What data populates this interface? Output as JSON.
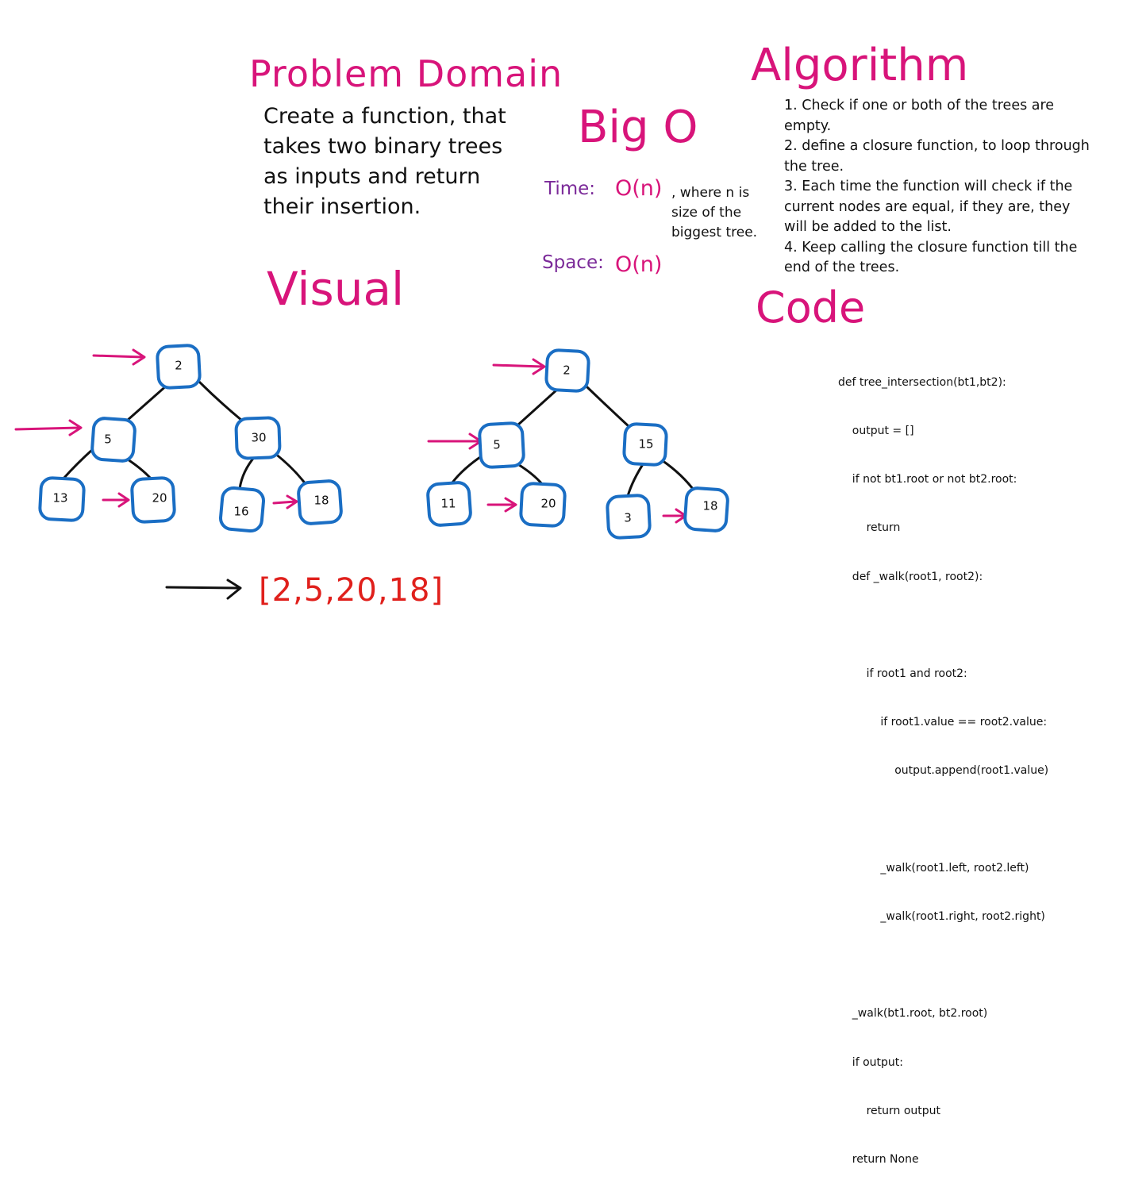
{
  "headings": {
    "problem_domain": "Problem Domain",
    "algorithm": "Algorithm",
    "big_o": "Big O",
    "visual": "Visual",
    "code": "Code"
  },
  "problem_domain": {
    "lines": [
      "Create a function, that",
      "takes two binary trees",
      "as inputs and return",
      "their insertion."
    ]
  },
  "big_o": {
    "time_label": "Time:",
    "time_value": "O(n)",
    "time_note": [
      ", where n is",
      "size of the",
      "biggest tree."
    ],
    "space_label": "Space:",
    "space_value": "O(n)"
  },
  "algorithm": {
    "lines": [
      "1. Check if one or both of the trees are",
      "empty.",
      "2. define a closure function, to loop through",
      "the tree.",
      "3. Each time the function will check if the",
      "current nodes are equal, if they are, they",
      "will be added to the list.",
      "4. Keep calling the closure function till the",
      "end of the trees."
    ]
  },
  "code": {
    "lines": [
      "def tree_intersection(bt1,bt2):",
      "    output = []",
      "    if not bt1.root or not bt2.root:",
      "        return",
      "    def _walk(root1, root2):",
      "",
      "        if root1 and root2:",
      "            if root1.value == root2.value:",
      "                output.append(root1.value)",
      "",
      "            _walk(root1.left, root2.left)",
      "            _walk(root1.right, root2.right)",
      "",
      "    _walk(bt1.root, bt2.root)",
      "    if output:",
      "        return output",
      "    return None"
    ]
  },
  "trees": {
    "tree1": {
      "nodes": [
        {
          "id": "t1-root",
          "value": "2"
        },
        {
          "id": "t1-left",
          "value": "5"
        },
        {
          "id": "t1-right",
          "value": "30"
        },
        {
          "id": "t1-ll",
          "value": "13"
        },
        {
          "id": "t1-lr",
          "value": "20"
        },
        {
          "id": "t1-rl",
          "value": "16"
        },
        {
          "id": "t1-rr",
          "value": "18"
        }
      ]
    },
    "tree2": {
      "nodes": [
        {
          "id": "t2-root",
          "value": "2"
        },
        {
          "id": "t2-left",
          "value": "5"
        },
        {
          "id": "t2-right",
          "value": "15"
        },
        {
          "id": "t2-ll",
          "value": "11"
        },
        {
          "id": "t2-lr",
          "value": "20"
        },
        {
          "id": "t2-rl",
          "value": "3"
        },
        {
          "id": "t2-rr",
          "value": "18"
        }
      ]
    }
  },
  "result": "[2,5,20,18]",
  "colors": {
    "heading": "#d8147a",
    "purple": "#7b2a99",
    "node_border": "#1a6ec4",
    "result": "#e0201c"
  }
}
